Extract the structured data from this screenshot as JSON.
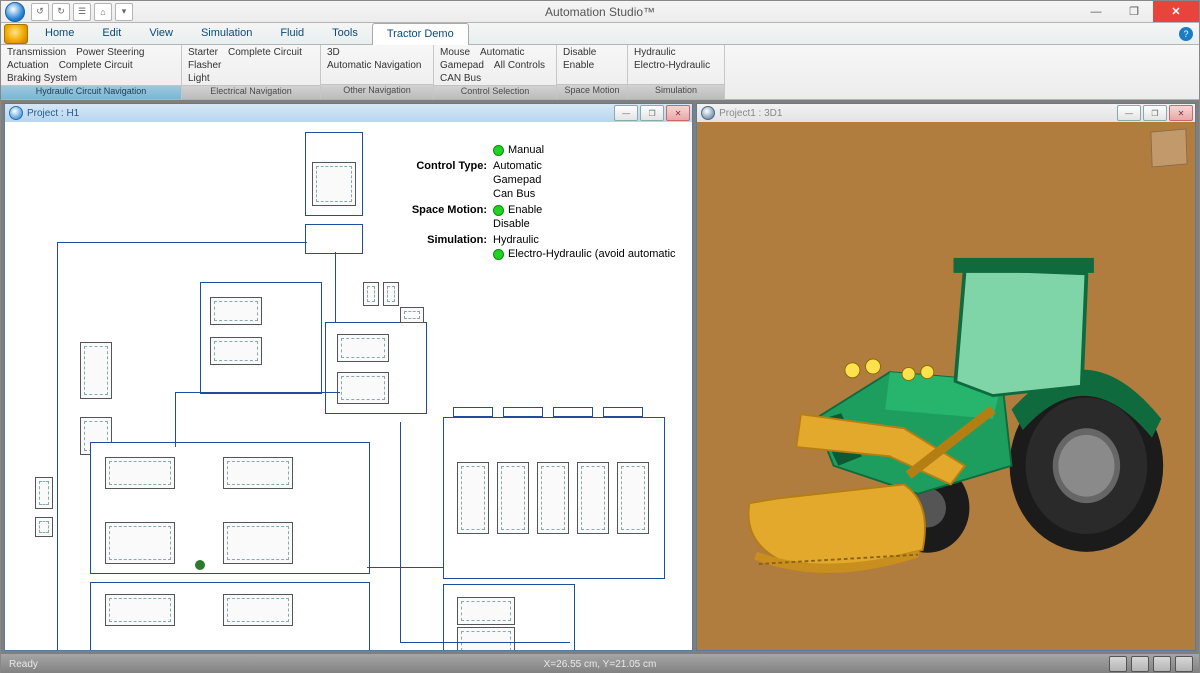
{
  "app": {
    "title": "Automation Studio™"
  },
  "qat": {
    "b0": "↺",
    "b1": "↻",
    "b2": "☰",
    "b3": "⌂",
    "b4": "▾"
  },
  "win": {
    "min": "—",
    "max": "❐",
    "close": "✕"
  },
  "menu": {
    "tabs": [
      "Home",
      "Edit",
      "View",
      "Simulation",
      "Fluid",
      "Tools",
      "Tractor Demo"
    ],
    "activeIndex": 6
  },
  "ribbon": {
    "groups": [
      {
        "title": "Hydraulic Circuit Navigation",
        "rows": [
          [
            "Transmission",
            "Power Steering"
          ],
          [
            "Actuation",
            "Complete Circuit"
          ],
          [
            "Braking System",
            ""
          ]
        ]
      },
      {
        "title": "Electrical Navigation",
        "rows": [
          [
            "Starter",
            "Complete Circuit"
          ],
          [
            "Flasher",
            ""
          ],
          [
            "Light",
            ""
          ]
        ]
      },
      {
        "title": "Other Navigation",
        "rows": [
          [
            "3D",
            ""
          ],
          [
            "Automatic Navigation",
            ""
          ],
          [
            "",
            ""
          ]
        ]
      },
      {
        "title": "Control Selection",
        "rows": [
          [
            "Mouse",
            "Automatic"
          ],
          [
            "Gamepad",
            "All Controls"
          ],
          [
            "CAN Bus",
            ""
          ]
        ]
      },
      {
        "title": "Space Motion",
        "rows": [
          [
            "Disable",
            ""
          ],
          [
            "Enable",
            ""
          ],
          [
            "",
            ""
          ]
        ]
      },
      {
        "title": "Simulation",
        "rows": [
          [
            "Hydraulic",
            ""
          ],
          [
            "Electro-Hydraulic",
            ""
          ],
          [
            "",
            ""
          ]
        ]
      }
    ]
  },
  "panes": {
    "left": {
      "title": "Project : H1"
    },
    "right": {
      "title": "Project1 : 3D1"
    }
  },
  "control_panel": {
    "rows": [
      {
        "label": "",
        "values": [
          "Manual"
        ],
        "dots": [
          true
        ]
      },
      {
        "label": "Control Type:",
        "values": [
          "Automatic",
          "Gamepad",
          "Can Bus"
        ],
        "dots": [
          false,
          false,
          false
        ]
      },
      {
        "label": "Space Motion:",
        "values": [
          "Enable",
          "Disable"
        ],
        "dots": [
          true,
          false
        ]
      },
      {
        "label": "Simulation:",
        "values": [
          "Hydraulic",
          "Electro-Hydraulic (avoid automatic"
        ],
        "dots": [
          false,
          true
        ]
      }
    ]
  },
  "status": {
    "ready": "Ready",
    "coords": "X=26.55 cm, Y=21.05 cm"
  },
  "colors": {
    "tractor_body": "#1e9e5e",
    "tractor_body_dark": "#0f6a3e",
    "loader": "#e3a92d",
    "loader_dark": "#b57e12",
    "tire": "#1b1b1b",
    "scene_bg": "#b07d3e"
  }
}
